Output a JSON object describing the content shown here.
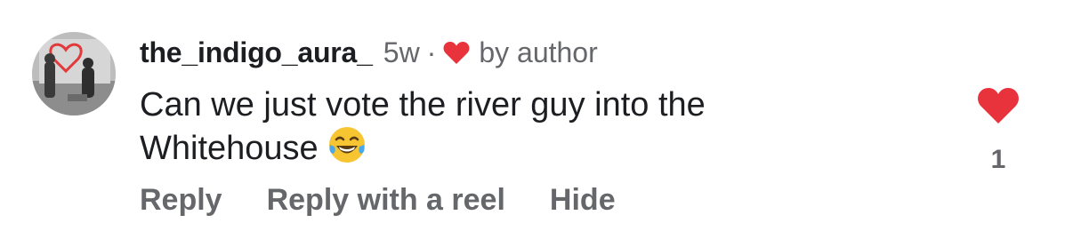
{
  "comment": {
    "username": "the_indigo_aura_",
    "time_ago": "5w",
    "separator": "·",
    "author_badge": "by author",
    "text": "Can we just vote the river guy into the Whitehouse",
    "emoji": "face-with-tears-of-joy",
    "like_count": "1",
    "actions": {
      "reply": "Reply",
      "reply_with_reel": "Reply with a reel",
      "hide": "Hide"
    },
    "icons": {
      "author_heart": "heart-icon",
      "like": "heart-icon"
    },
    "colors": {
      "heart": "#e8323c",
      "secondary_text": "#65676b",
      "primary_text": "#1c1e21"
    }
  }
}
